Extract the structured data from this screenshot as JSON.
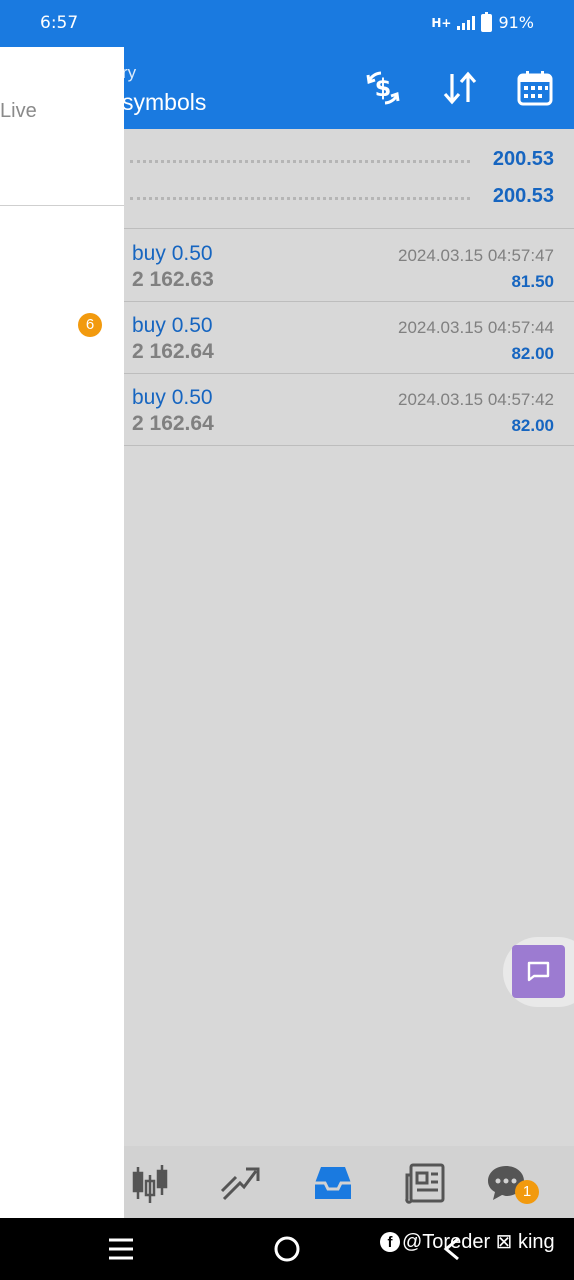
{
  "status_bar": {
    "time": "6:57",
    "network": "H+",
    "battery": "91%"
  },
  "header": {
    "subtitle": "ry",
    "title": "symbols"
  },
  "totals": [
    "200.53",
    "200.53"
  ],
  "deals": [
    {
      "type": "buy 0.50",
      "price": "2 162.63",
      "time": "2024.03.15 04:57:47",
      "profit": "81.50"
    },
    {
      "type": "buy 0.50",
      "price": "2 162.64",
      "time": "2024.03.15 04:57:44",
      "profit": "82.00"
    },
    {
      "type": "buy 0.50",
      "price": "2 162.64",
      "time": "2024.03.15 04:57:42",
      "profit": "82.00"
    }
  ],
  "drawer": {
    "live_label": "Live",
    "badge_count": "6"
  },
  "bottom_nav": {
    "items": [
      "quotes",
      "trade",
      "history",
      "news",
      "messages"
    ],
    "active": "history",
    "messages_badge": "1"
  },
  "watermark": {
    "text": "@Toreder ⊠ king"
  },
  "colors": {
    "primary": "#1a7ae0",
    "value_blue": "#1665c0",
    "badge_orange": "#f29a0e",
    "chat_purple": "#9c7bd1"
  }
}
